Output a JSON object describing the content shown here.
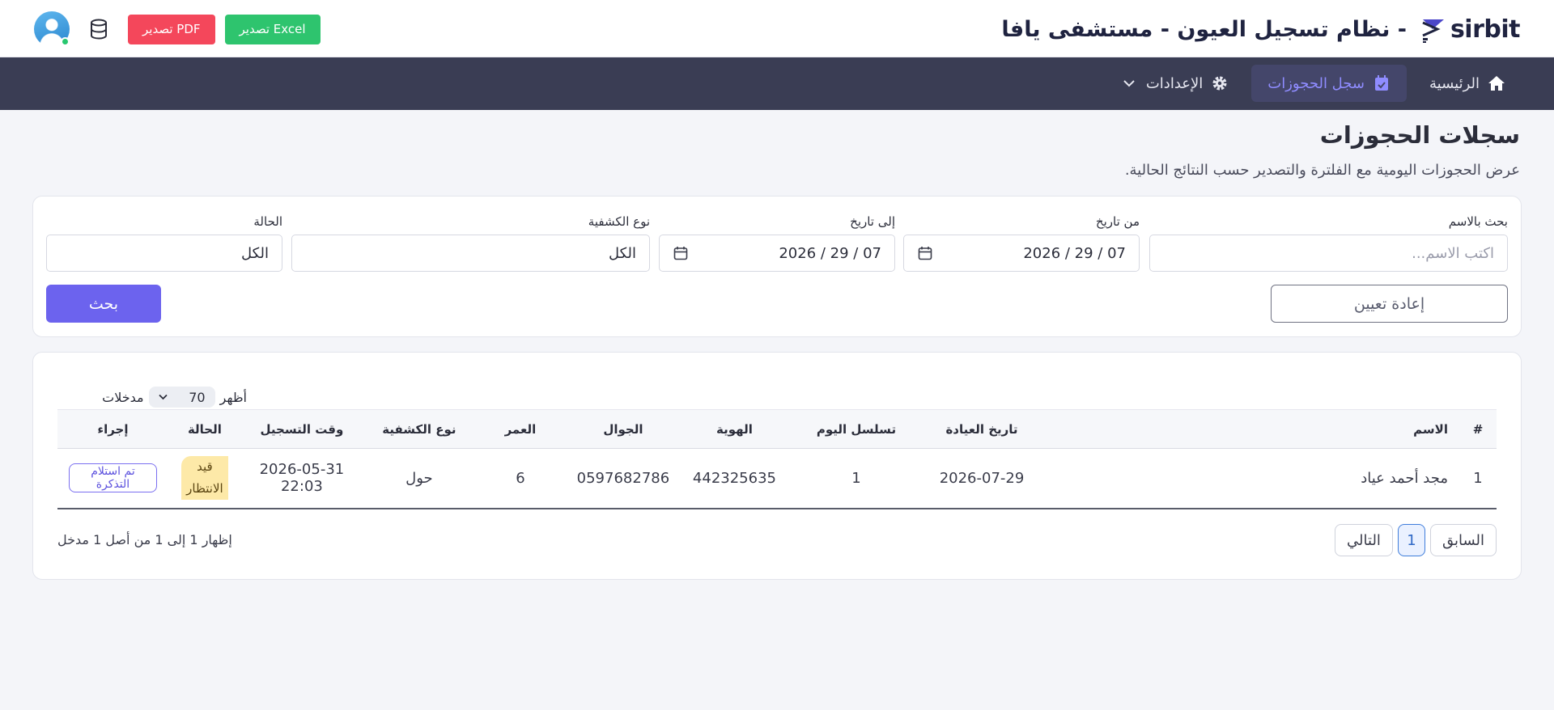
{
  "header": {
    "logo_text": "sirbit",
    "app_title": "- نظام تسجيل العيون - مستشفى يافا",
    "export_excel_label": "تصدير Excel",
    "export_pdf_label": "تصدير PDF"
  },
  "nav": {
    "items": [
      {
        "label": "الرئيسية",
        "icon": "home-icon"
      },
      {
        "label": "سجل الحجوزات",
        "icon": "calendar-check-icon",
        "active": true
      },
      {
        "label": "الإعدادات",
        "icon": "gear-icon",
        "has_dropdown": true
      }
    ]
  },
  "page": {
    "title": "سجلات الحجوزات",
    "subtitle": "عرض الحجوزات اليومية مع الفلترة والتصدير حسب النتائج الحالية."
  },
  "filters": {
    "name_label": "بحث بالاسم",
    "name_placeholder": "اكتب الاسم...",
    "from_date_label": "من تاريخ",
    "from_date_value": "07 / 29 / 2026",
    "to_date_label": "إلى تاريخ",
    "to_date_value": "07 / 29 / 2026",
    "exam_type_label": "نوع الكشفية",
    "exam_type_value": "الكل",
    "status_label": "الحالة",
    "status_value": "الكل",
    "reset_label": "إعادة تعيين",
    "search_label": "بحث"
  },
  "table": {
    "show_label": "أظهر",
    "entries_value": "70",
    "entries_label": "مدخلات",
    "columns": [
      "#",
      "الاسم",
      "تاريخ العيادة",
      "تسلسل اليوم",
      "الهوية",
      "الجوال",
      "العمر",
      "نوع الكشفية",
      "وقت التسجيل",
      "الحالة",
      "إجراء"
    ],
    "rows": [
      {
        "num": "1",
        "name": "مجد أحمد عياد",
        "clinic_date": "2026-07-29",
        "day_seq": "1",
        "id_number": "442325635",
        "mobile": "0597682786",
        "age": "6",
        "exam_type": "حول",
        "registered_at": "2026-05-31 22:03",
        "status_line1": "قيد",
        "status_line2": "الانتظار",
        "action_label": "تم استلام التذكرة"
      }
    ]
  },
  "pagination": {
    "prev_label": "السابق",
    "current_page": "1",
    "next_label": "التالي",
    "info": "إظهار 1 إلى 1 من أصل 1 مدخل"
  },
  "colors": {
    "primary": "#6c63ee",
    "navbar": "#3a3d54",
    "excel": "#2ec46e",
    "pdf": "#f4475b",
    "status_pending": "#fde9a8"
  }
}
